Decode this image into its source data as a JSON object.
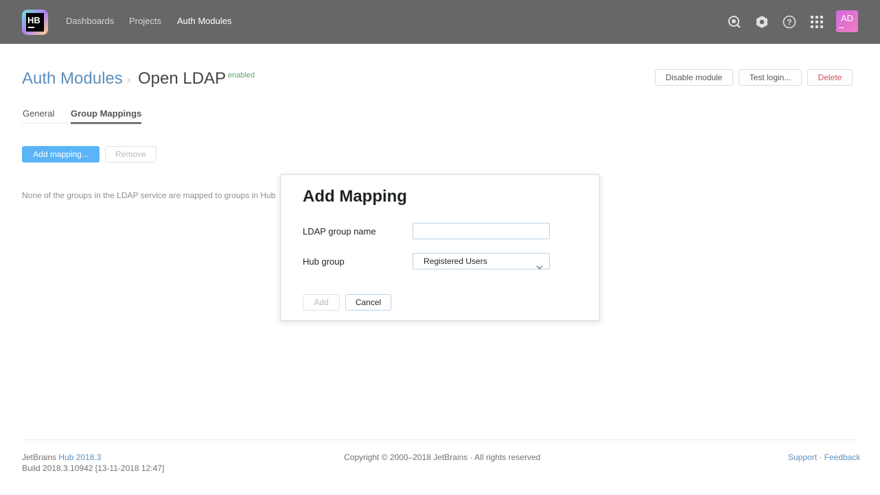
{
  "header": {
    "logo_text": "HB",
    "nav": [
      {
        "label": "Dashboards"
      },
      {
        "label": "Projects"
      },
      {
        "label": "Auth Modules"
      }
    ],
    "avatar_initials": "AD",
    "icons": [
      "search-icon",
      "settings-icon",
      "help-icon",
      "apps-grid-icon"
    ]
  },
  "page": {
    "breadcrumb_parent": "Auth Modules",
    "breadcrumb_separator": "›",
    "title": "Open LDAP",
    "status_badge": "enabled",
    "actions": {
      "disable": "Disable module",
      "test_login": "Test login...",
      "delete": "Delete"
    },
    "tabs": [
      {
        "label": "General"
      },
      {
        "label": "Group Mappings"
      }
    ],
    "add_mapping_button": "Add mapping...",
    "remove_button": "Remove",
    "empty_message": "None of the groups in the LDAP service are mapped to groups in Hub"
  },
  "dialog": {
    "title": "Add Mapping",
    "ldap_label": "LDAP group name",
    "ldap_value": "",
    "hub_label": "Hub group",
    "hub_selected": "Registered Users",
    "add_button": "Add",
    "cancel_button": "Cancel"
  },
  "footer": {
    "company": "JetBrains",
    "product": "Hub 2018.3",
    "build": "Build 2018.3.10942 [13-11-2018 12:47]",
    "copyright": "Copyright © 2000–2018 JetBrains · All rights reserved",
    "support": "Support",
    "separator": "·",
    "feedback": "Feedback"
  },
  "colors": {
    "header_bg": "#676767",
    "link": "#5d8fbd",
    "primary": "#5ab4f5",
    "enabled": "#59a869",
    "danger": "#d64c56"
  }
}
